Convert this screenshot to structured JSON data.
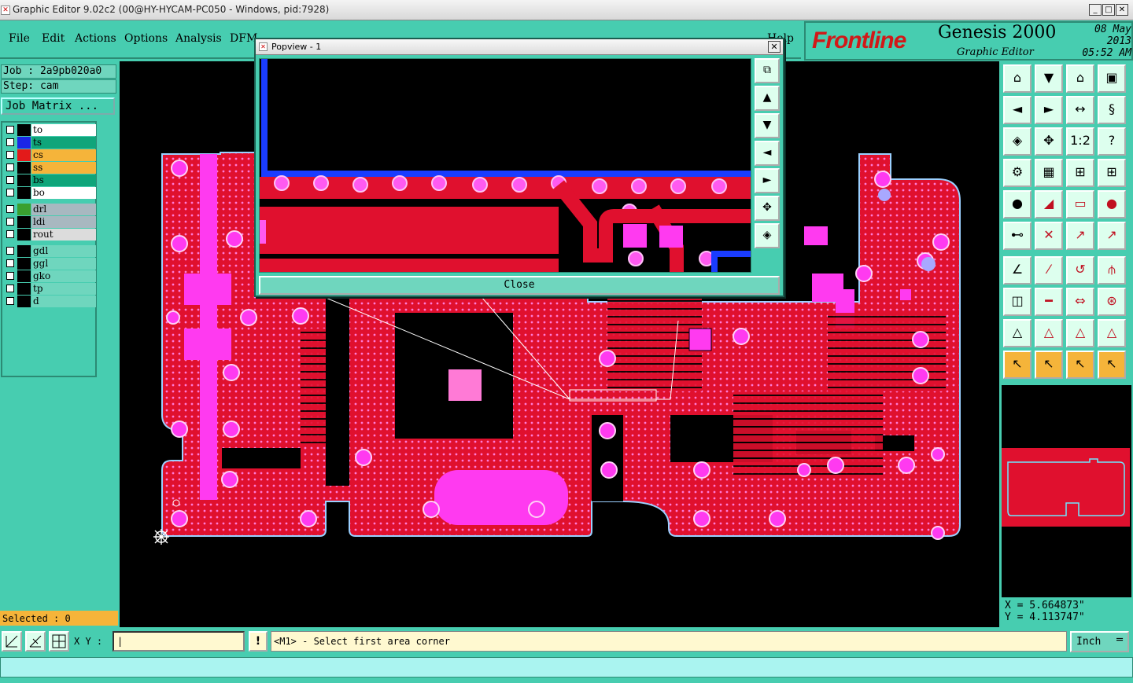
{
  "window": {
    "title": "Graphic Editor 9.02c2 (00@HY-HYCAM-PC050 - Windows, pid:7928)"
  },
  "menu": [
    "File",
    "Edit",
    "Actions",
    "Options",
    "Analysis",
    "DFM",
    "Help"
  ],
  "brand": {
    "logo": "Frontline",
    "product": "Genesis 2000",
    "subtitle": "Graphic Editor",
    "date": "08 May 2013",
    "time": "05:52 AM"
  },
  "job": {
    "job": "Job : 2a9pb020a0",
    "step": "Step: cam",
    "matrix_button": "Job Matrix ..."
  },
  "layers": [
    {
      "name": "to",
      "color": "#ffffff",
      "swatch": "#000000"
    },
    {
      "name": "ts",
      "color": "#0fa57a",
      "swatch": "#1a26e6"
    },
    {
      "name": "cs",
      "color": "#f5b43a",
      "swatch": "#e31a1a"
    },
    {
      "name": "ss",
      "color": "#f5b43a",
      "swatch": "#000000"
    },
    {
      "name": "bs",
      "color": "#0fa57a",
      "swatch": "#000000"
    },
    {
      "name": "bo",
      "color": "#ffffff",
      "swatch": "#000000"
    },
    {
      "name": "drl",
      "color": "#a8b8c0",
      "swatch": "#3aa030"
    },
    {
      "name": "ldi",
      "color": "#a8b8c0",
      "swatch": "#000000"
    },
    {
      "name": "rout",
      "color": "#dcdcdc",
      "swatch": "#000000"
    },
    {
      "name": "gdl",
      "color": "#6fd6be",
      "swatch": "#000000"
    },
    {
      "name": "ggl",
      "color": "#6fd6be",
      "swatch": "#000000"
    },
    {
      "name": "gko",
      "color": "#6fd6be",
      "swatch": "#000000"
    },
    {
      "name": "tp",
      "color": "#6fd6be",
      "swatch": "#000000"
    },
    {
      "name": "d",
      "color": "#6fd6be",
      "swatch": "#000000"
    }
  ],
  "selected": "Selected : 0",
  "popup": {
    "title": "Popview - 1",
    "close_label": "Close"
  },
  "coords": {
    "x": "X = 5.664873\"",
    "y": "Y = 4.113747\""
  },
  "bottom": {
    "xy_label": "X Y :",
    "prompt": "<M1> - Select first area corner",
    "unit": "Inch"
  }
}
